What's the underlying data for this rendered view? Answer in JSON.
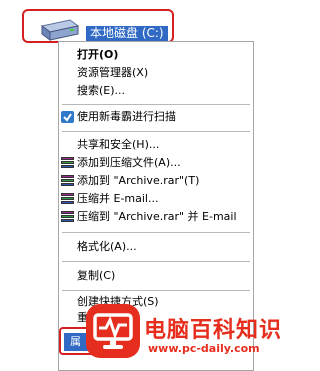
{
  "desktop": {
    "drive_label": "本地磁盘 (C:)",
    "drive_icon": "hard-drive-icon"
  },
  "menu": {
    "open": "打开(O)",
    "explorer": "资源管理器(X)",
    "search": "搜索(E)...",
    "scan": "使用新毒霸进行扫描",
    "share": "共享和安全(H)...",
    "add_archive": "添加到压缩文件(A)...",
    "add_rar": "添加到 \"Archive.rar\"(T)",
    "compress_email": "压缩并 E-mail...",
    "compress_rar_email": "压缩到 \"Archive.rar\" 并 E-mail",
    "format": "格式化(A)...",
    "copy": "复制(C)",
    "shortcut": "创建快捷方式(S)",
    "rename": "重命",
    "properties": "属"
  },
  "watermark": {
    "title": "电脑百科知识",
    "url": "www.pc-daily.com"
  },
  "colors": {
    "selection": "#316ac5",
    "highlight_border": "#d42020",
    "watermark": "#e62e1e"
  }
}
